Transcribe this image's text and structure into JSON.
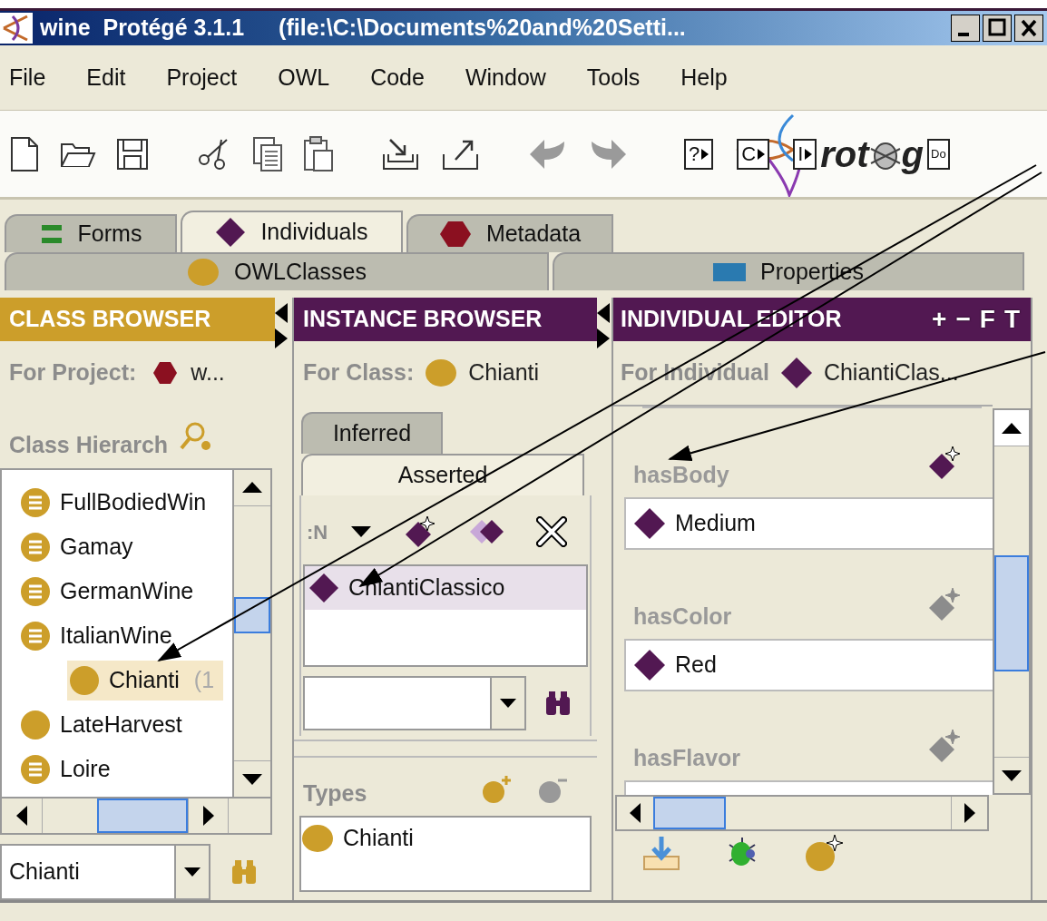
{
  "window": {
    "app": "wine  Protégé 3.1.1",
    "path": "(file:\\C:\\Documents%20and%20Setti..."
  },
  "menu": [
    "File",
    "Edit",
    "Project",
    "OWL",
    "Code",
    "Window",
    "Tools",
    "Help"
  ],
  "logo": {
    "buttons": [
      "?",
      "C",
      "I",
      "Do"
    ],
    "text_start": "rot",
    "text_end": "g"
  },
  "tabs": [
    [
      {
        "label": "Forms",
        "kind": "forms",
        "selected": false
      },
      {
        "label": "Individuals",
        "kind": "individuals",
        "selected": true
      },
      {
        "label": "Metadata",
        "kind": "metadata",
        "selected": false
      }
    ],
    [
      {
        "label": "OWLClasses",
        "kind": "classes",
        "selected": false
      },
      {
        "label": "Properties",
        "kind": "properties",
        "selected": false
      }
    ]
  ],
  "class_browser": {
    "title": "CLASS BROWSER",
    "project_label": "For Project:",
    "project": "w...",
    "hierarchy_label": "Class Hierarch",
    "tree": [
      {
        "label": "FullBodiedWin",
        "kind": "defined",
        "selected": false
      },
      {
        "label": "Gamay",
        "kind": "defined",
        "selected": false
      },
      {
        "label": "GermanWine",
        "kind": "defined",
        "selected": false
      },
      {
        "label": "ItalianWine",
        "kind": "defined",
        "selected": false,
        "children": [
          {
            "label": "Chianti",
            "count": "(1",
            "kind": "primitive",
            "selected": true
          }
        ]
      },
      {
        "label": "LateHarvest",
        "kind": "primitive",
        "selected": false
      },
      {
        "label": "Loire",
        "kind": "defined",
        "selected": false
      }
    ],
    "search_value": "Chianti"
  },
  "instance_browser": {
    "title": "INSTANCE BROWSER",
    "class_label": "For Class:",
    "class": "Chianti",
    "tabs": [
      {
        "label": "Inferred",
        "selected": false
      },
      {
        "label": "Asserted",
        "selected": true
      }
    ],
    "sort_label": ":N",
    "instances": [
      {
        "label": "ChiantiClassico",
        "selected": true
      }
    ],
    "types_label": "Types",
    "types": [
      "Chianti"
    ]
  },
  "individual_editor": {
    "title": "INDIVIDUAL EDITOR",
    "header_buttons": [
      "+",
      "−",
      "F",
      "T"
    ],
    "individual_label": "For Individual",
    "individual": "ChiantiClas...",
    "properties": [
      {
        "name": "hasBody",
        "add_enabled": true,
        "values": [
          "Medium"
        ]
      },
      {
        "name": "hasColor",
        "add_enabled": false,
        "values": [
          "Red"
        ]
      },
      {
        "name": "hasFlavor",
        "add_enabled": false
      }
    ]
  }
}
